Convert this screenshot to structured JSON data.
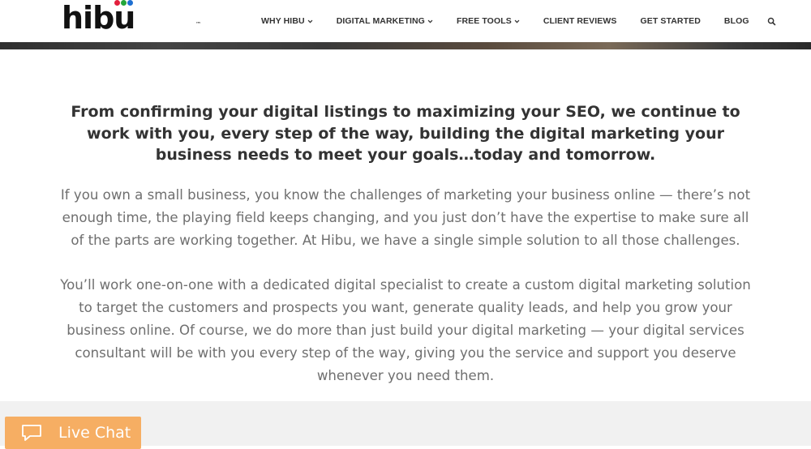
{
  "brand": {
    "logo_text": "hibu",
    "trademark": "™",
    "dot_colors": [
      "#e21f3c",
      "#22a63b",
      "#1d6fd1"
    ]
  },
  "nav": {
    "items": [
      {
        "label": "WHY HIBU",
        "has_dropdown": true
      },
      {
        "label": "DIGITAL MARKETING",
        "has_dropdown": true
      },
      {
        "label": "FREE TOOLS",
        "has_dropdown": true
      },
      {
        "label": "CLIENT REVIEWS",
        "has_dropdown": false
      },
      {
        "label": "GET STARTED",
        "has_dropdown": false
      },
      {
        "label": "BLOG",
        "has_dropdown": false
      }
    ],
    "search_icon": "search-icon"
  },
  "main": {
    "headline": "From confirming your digital listings to maximizing your SEO, we continue to work with you, every step of the way, building the digital marketing your business needs to meet your goals…today and tomorrow.",
    "paragraph_1": "If you own a small business, you know the challenges of marketing your business online — there’s not enough time, the playing field keeps changing, and you just don’t have the expertise to make sure all of the parts are working together. At Hibu, we have a single simple solution to all those challenges.",
    "paragraph_2": "You’ll work one-on-one with a dedicated digital specialist to create a custom digital marketing solution to target the customers and prospects you want, generate quality leads, and help you grow your business online. Of course, we do more than just build your digital marketing — your digital services consultant will be with you every step of the way, giving you the service and support you deserve whenever you need them."
  },
  "chat": {
    "label": "Live Chat",
    "icon": "chat-bubble-icon",
    "color": "#f6ae63"
  }
}
